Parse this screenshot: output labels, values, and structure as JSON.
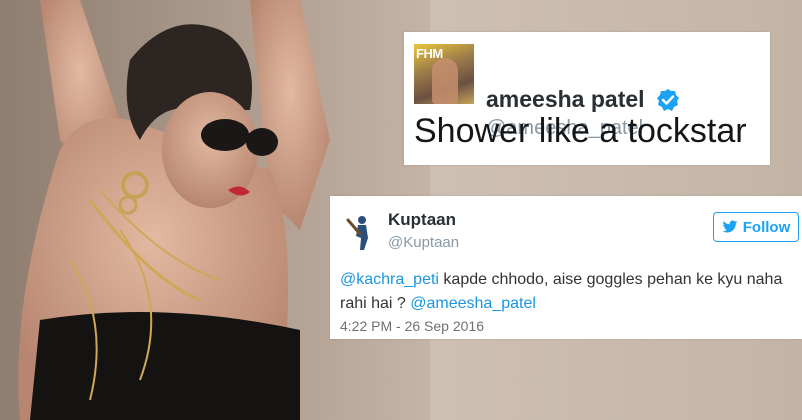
{
  "tweet_main": {
    "name": "ameesha patel",
    "handle": "@ameesha_patel",
    "text": "Shower like a tockstar",
    "avatar_text": "FHM"
  },
  "tweet_reply": {
    "name": "Kuptaan",
    "handle": "@Kuptaan",
    "follow_label": "Follow",
    "mention_1": "@kachra_peti",
    "text_body": " kapde chhodo, aise goggles pehan ke kyu naha rahi hai ? ",
    "mention_2": "@ameesha_patel",
    "timestamp": "4:22 PM - 26 Sep 2016"
  },
  "colors": {
    "twitter_blue": "#1da1f2",
    "mention_blue": "#1b95e0",
    "background": "#c7b7ab"
  },
  "icons": [
    "verified-badge-icon",
    "twitter-bird-icon",
    "cricket-avatar-icon"
  ]
}
